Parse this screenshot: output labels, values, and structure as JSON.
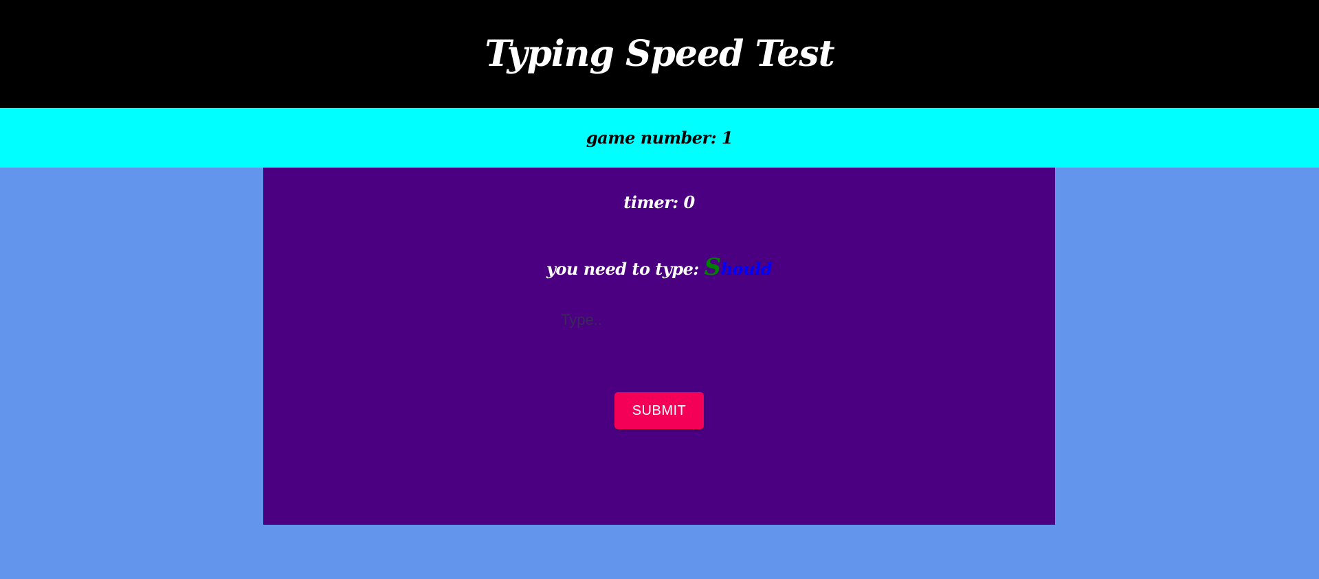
{
  "header": {
    "title": "Typing Speed Test"
  },
  "game": {
    "label": "game number: 1"
  },
  "panel": {
    "timer_label": "timer: 0",
    "prompt_label": "you need to type:",
    "word_first_letter": "S",
    "word_rest": "hould",
    "input_placeholder": "Type..",
    "input_value": "",
    "submit_label": "SUBMIT"
  },
  "colors": {
    "header_bg": "#000000",
    "game_bar_bg": "#00FFFF",
    "page_bg": "#6495ED",
    "panel_bg": "#4B0082",
    "typed_letter": "#008000",
    "remaining_letters": "#0000FF",
    "submit_bg": "#F50057"
  }
}
